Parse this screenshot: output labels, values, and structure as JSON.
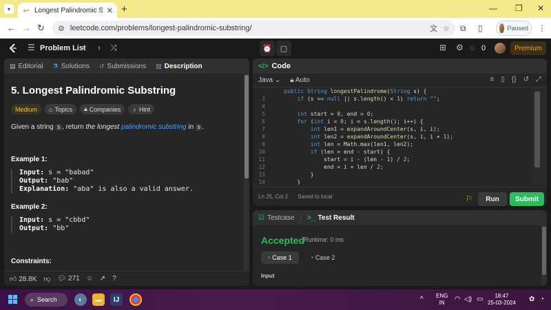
{
  "browser": {
    "tab_title": "Longest Palindromic Substring",
    "url": "leetcode.com/problems/longest-palindromic-substring/",
    "profile_status": "Paused"
  },
  "nav": {
    "problem_list": "Problem List",
    "streak_count": "0",
    "premium": "Premium"
  },
  "left": {
    "tabs": [
      {
        "label": "Editorial"
      },
      {
        "label": "Solutions"
      },
      {
        "label": "Submissions"
      },
      {
        "label": "Description"
      }
    ],
    "title": "5. Longest Palindromic Substring",
    "chips": {
      "difficulty": "Medium",
      "topics": "Topics",
      "companies": "Companies",
      "hint": "Hint"
    },
    "desc": {
      "p1": "Given a string ",
      "s": "s",
      "p2": ", return ",
      "em": "the longest",
      "link": "palindromic substring",
      "p3": " in ",
      "p4": "."
    },
    "example1": {
      "title": "Example 1:",
      "input_label": "Input:",
      "input": "s = \"babad\"",
      "output_label": "Output:",
      "output": "\"bab\"",
      "expl_label": "Explanation:",
      "expl": "\"aba\" is also a valid answer."
    },
    "example2": {
      "title": "Example 2:",
      "input_label": "Input:",
      "input": "s = \"cbbd\"",
      "output_label": "Output:",
      "output": "\"bb\""
    },
    "constraints": "Constraints:",
    "footer": {
      "likes": "28.8K",
      "comments": "271"
    }
  },
  "code": {
    "header": "Code",
    "language": "Java",
    "mode": "Auto",
    "status_pos": "Ln 25, Col 2",
    "status_saved": "Saved to local",
    "run": "Run",
    "submit": "Submit",
    "lines": [
      {
        "n": "",
        "t": "    public String longestPalindrome(String s) {"
      },
      {
        "n": "3",
        "t": "        if (s == null || s.length() < 1) return \"\";"
      },
      {
        "n": "4",
        "t": ""
      },
      {
        "n": "5",
        "t": "        int start = 0, end = 0;"
      },
      {
        "n": "6",
        "t": "        for (int i = 0; i < s.length(); i++) {"
      },
      {
        "n": "7",
        "t": "            int len1 = expandAroundCenter(s, i, i);"
      },
      {
        "n": "8",
        "t": "            int len2 = expandAroundCenter(s, i, i + 1);"
      },
      {
        "n": "9",
        "t": "            int len = Math.max(len1, len2);"
      },
      {
        "n": "10",
        "t": "            if (len > end - start) {"
      },
      {
        "n": "11",
        "t": "                start = i - (len - 1) / 2;"
      },
      {
        "n": "12",
        "t": "                end = i + len / 2;"
      },
      {
        "n": "13",
        "t": "            }"
      },
      {
        "n": "14",
        "t": "        }"
      }
    ]
  },
  "result": {
    "testcase_tab": "Testcase",
    "result_tab": "Test Result",
    "status": "Accepted",
    "runtime": "Runtime: 0 ms",
    "cases": [
      "Case 1",
      "Case 2"
    ],
    "input_label": "Input"
  },
  "taskbar": {
    "search": "Search",
    "lang_top": "ENG",
    "lang_bottom": "IN",
    "time": "18:47",
    "date": "25-03-2024"
  }
}
